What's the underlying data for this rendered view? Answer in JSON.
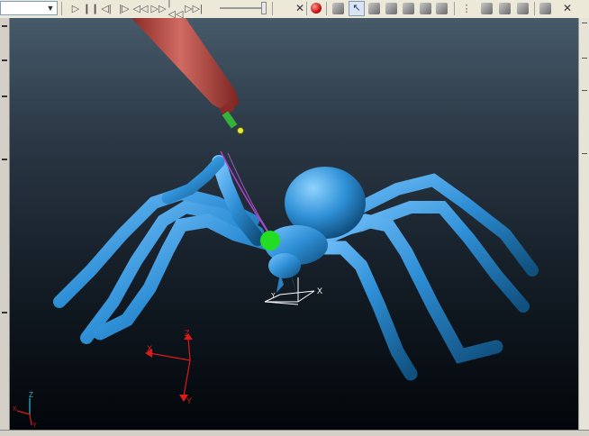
{
  "toolbar": {
    "combo_value": "",
    "buttons": [
      "play-icon",
      "pause-icon",
      "step-back-icon",
      "step-forward-icon",
      "rewind-icon",
      "fast-forward-icon",
      "first-frame-icon",
      "last-frame-icon"
    ],
    "view_buttons": [
      "solid-view-icon",
      "select-view-icon",
      "rotate-view-icon",
      "front-view-icon",
      "side-view-icon",
      "top-view-icon",
      "iso-view-icon",
      "refresh-view-icon"
    ],
    "record_color": "#cc1010",
    "active_color": "#dbe4f5"
  },
  "viewport": {
    "model_color": "#2e8fd6",
    "stylus_color": "#b0413c",
    "contact_point_color": "#22dd22",
    "selection_curve_color": "#b040d0",
    "local_axes": {
      "x_label": "X",
      "y_label": "Y"
    },
    "world_axes": {
      "x_label": "X",
      "y_label": "Y",
      "z_label": "Z",
      "color": "#dd1a1a"
    },
    "mini_axes": {
      "x_label": "X",
      "y_label": "Y",
      "z_label": "Z"
    }
  }
}
